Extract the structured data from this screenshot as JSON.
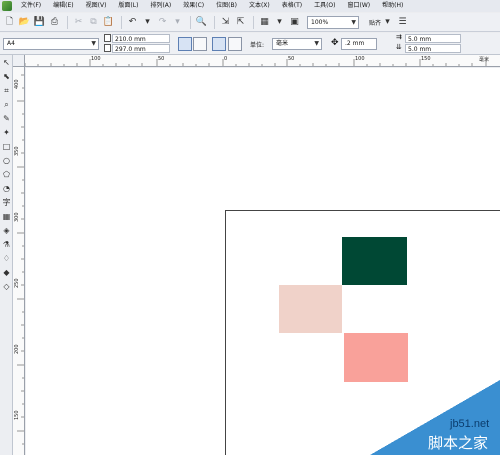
{
  "menu": {
    "items": [
      "文件(F)",
      "编辑(E)",
      "视图(V)",
      "版面(L)",
      "排列(A)",
      "效果(C)",
      "位图(B)",
      "文本(X)",
      "表格(T)",
      "工具(O)",
      "窗口(W)",
      "帮助(H)"
    ]
  },
  "toolbar": {
    "zoom_value": "100%",
    "snap_label": "贴齐"
  },
  "property_bar": {
    "page_size": "A4",
    "width": "210.0 mm",
    "height": "297.0 mm",
    "unit_label": "单位:",
    "unit_value": "毫米",
    "nudge": ".2 mm",
    "dup_x": "5.0 mm",
    "dup_y": "5.0 mm"
  },
  "rulers": {
    "top_labels": [
      "100",
      "50",
      "0",
      "50",
      "100",
      "150"
    ],
    "left_labels": [
      "400",
      "350",
      "300",
      "250",
      "200",
      "150"
    ],
    "top_unit": "毫米"
  },
  "shapes": {
    "dark_green": "#004834",
    "light_pink": "#f0d2c9",
    "salmon": "#f9a19a"
  },
  "watermark": {
    "site": "jb51.net",
    "name": "脚本之家"
  }
}
